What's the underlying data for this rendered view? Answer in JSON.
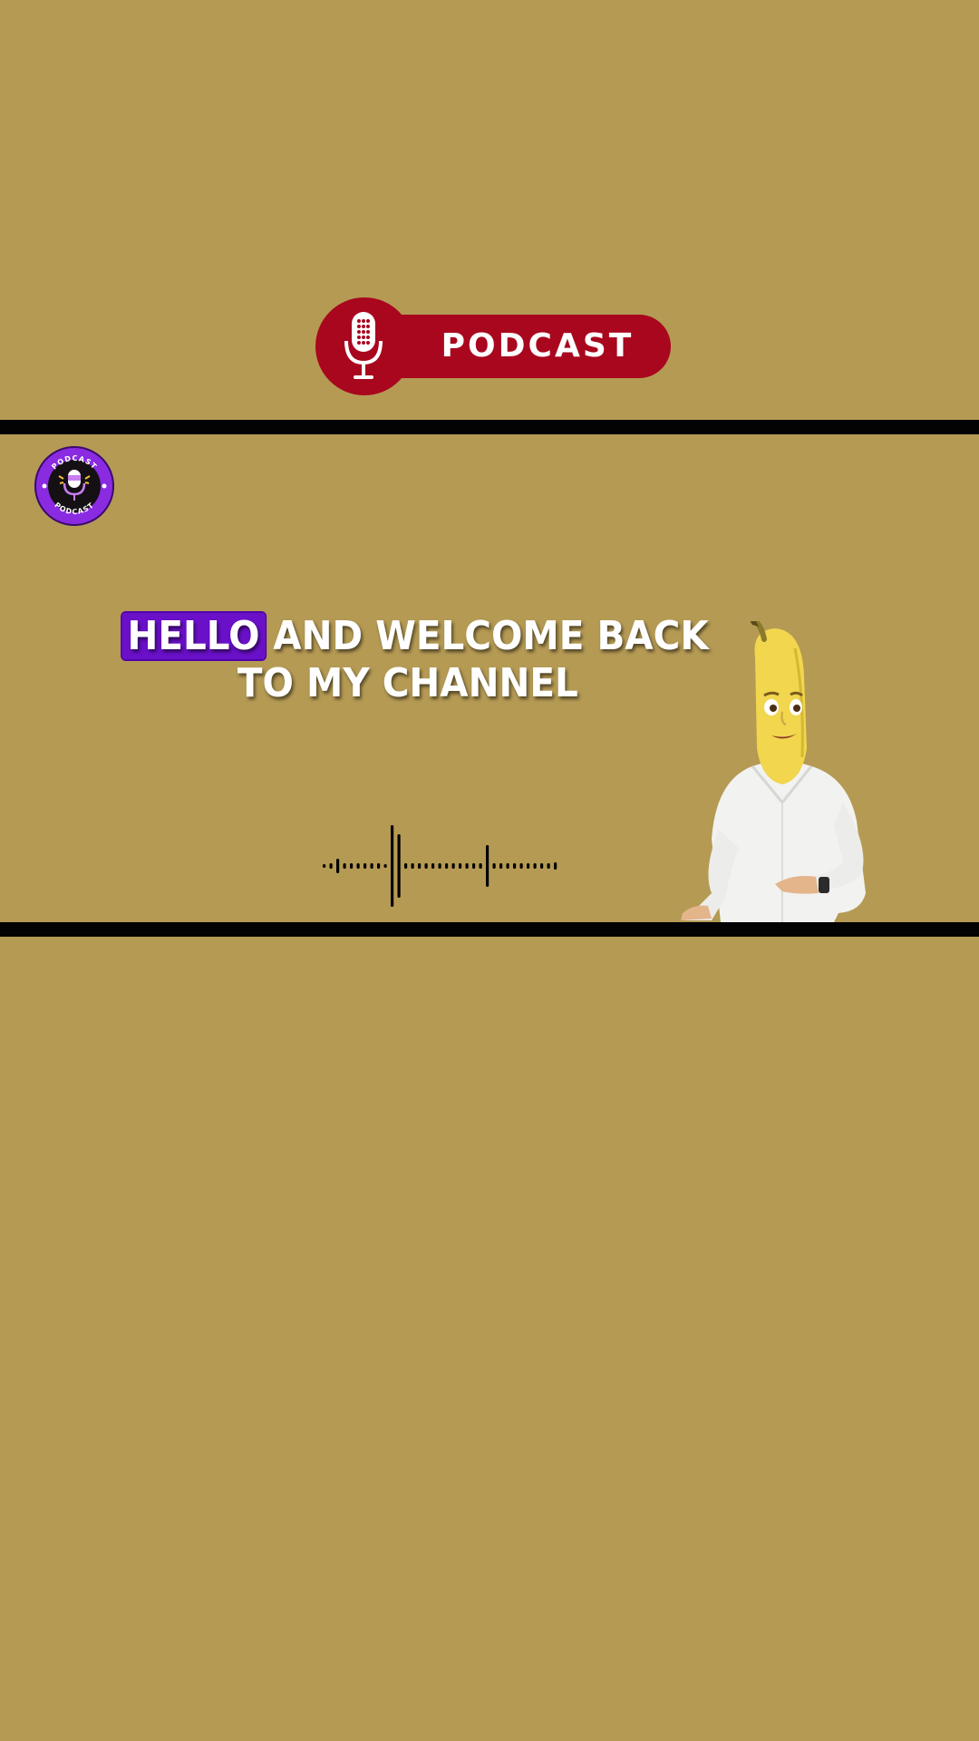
{
  "header": {
    "badge_label": "PODCAST",
    "badge_color": "#a8071e",
    "badge_icon": "microphone-icon"
  },
  "logo": {
    "ring_text_top": "PODCAST",
    "ring_text_bottom": "PODCAST",
    "ring_color": "#8a2be2",
    "icon": "microphone-icon"
  },
  "caption": {
    "highlighted_word": "HELLO",
    "line1_rest": "AND WELCOME BACK",
    "line2": "TO MY CHANNEL",
    "highlight_color": "#6a10c9"
  },
  "waveform": {
    "icon": "audio-waveform-icon"
  },
  "character": {
    "icon": "banana-man-avatar"
  },
  "colors": {
    "background": "#b59a54",
    "frame_bars": "#030303"
  }
}
